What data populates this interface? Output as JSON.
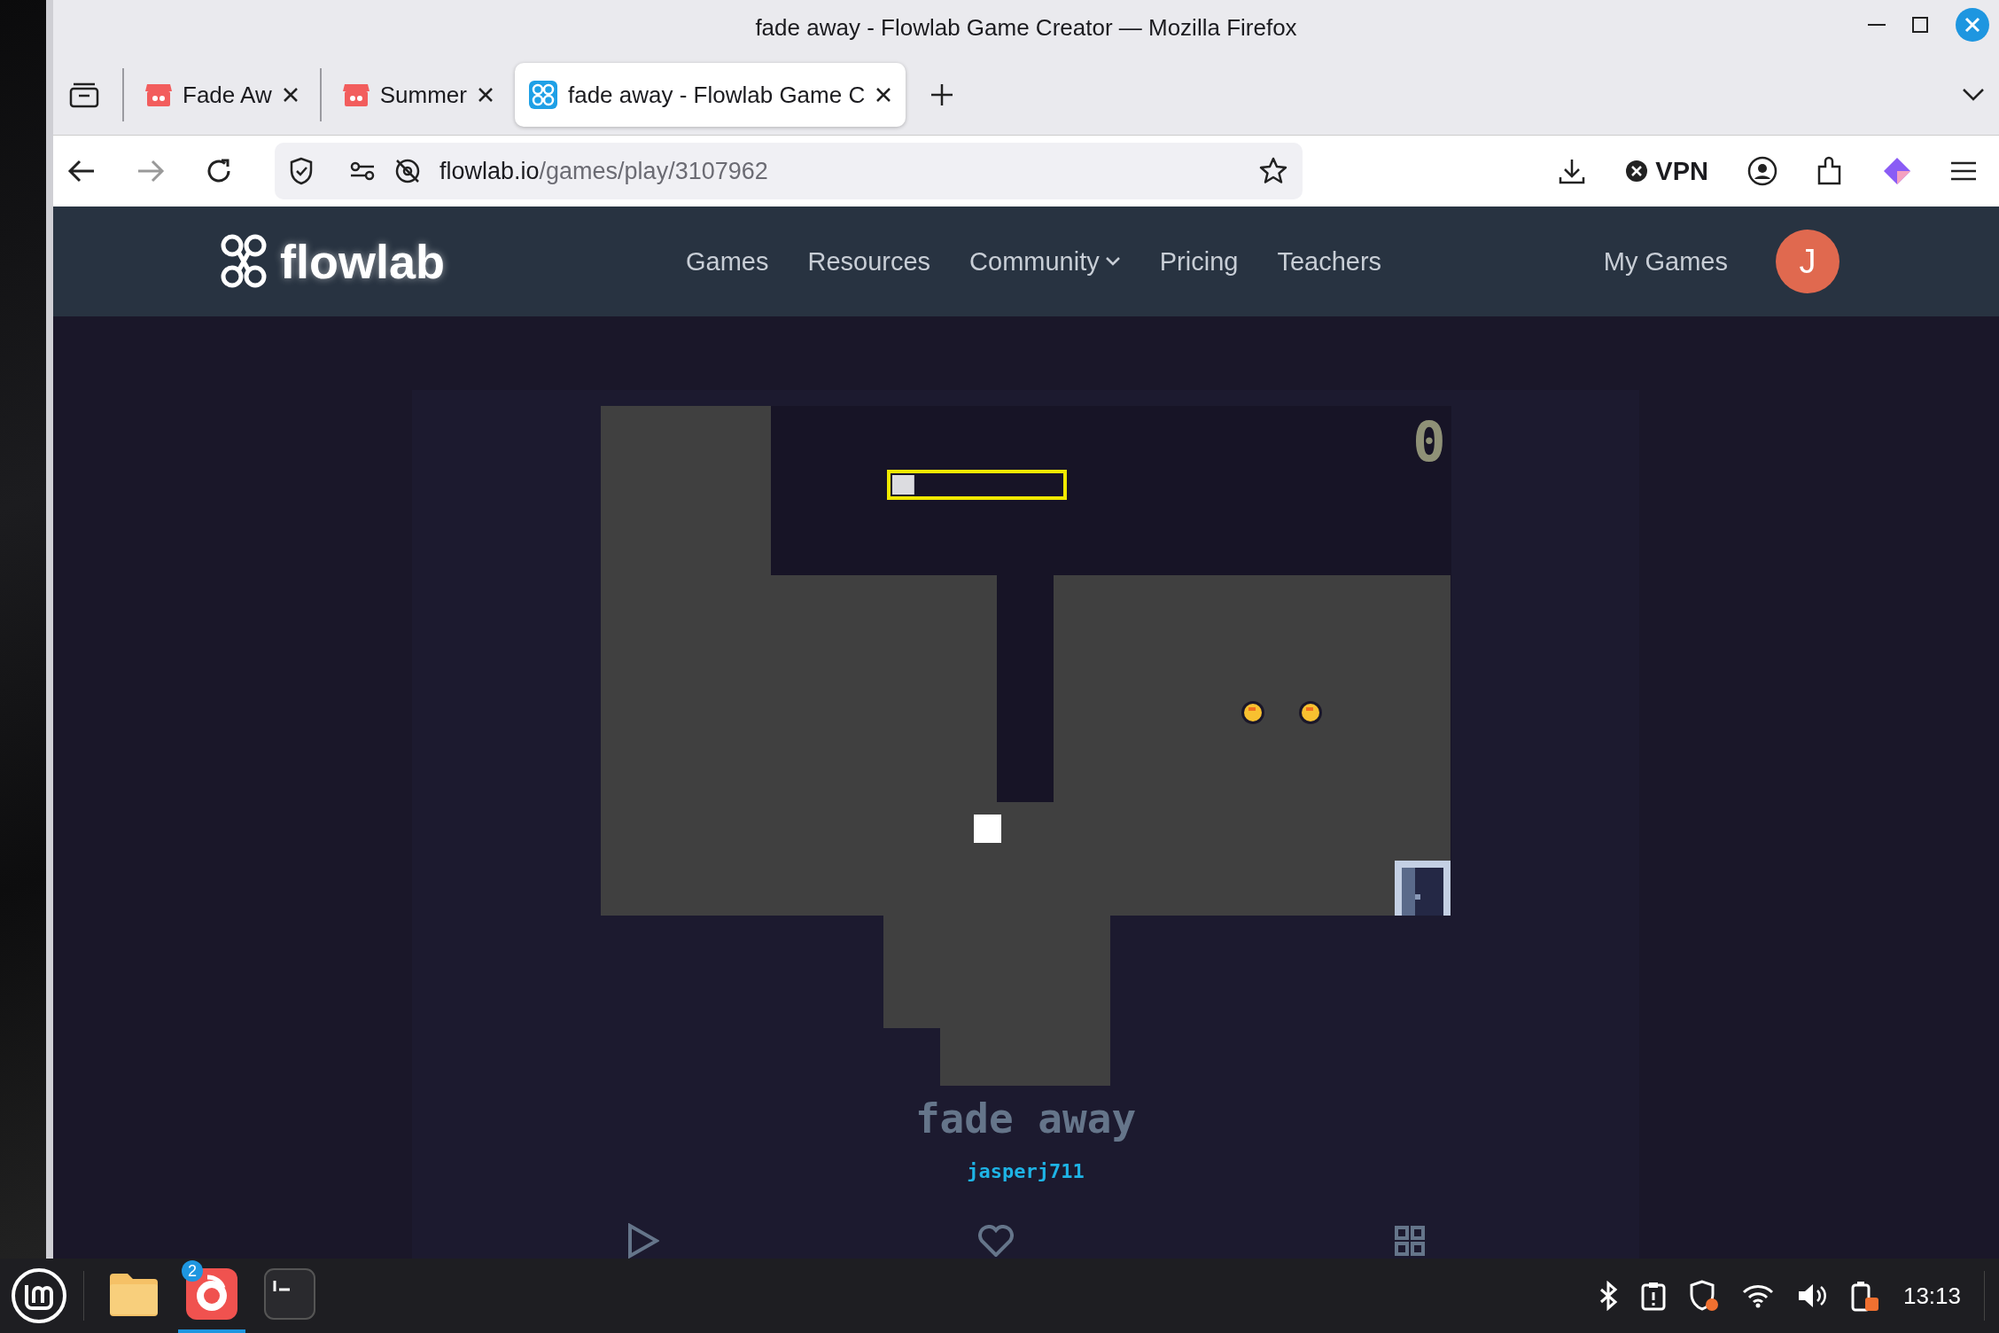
{
  "window": {
    "title": "fade away - Flowlab Game Creator — Mozilla Firefox"
  },
  "tabs": [
    {
      "label": "Fade Aw",
      "kind": "store",
      "selected": false
    },
    {
      "label": "Summer",
      "kind": "store",
      "selected": false
    },
    {
      "label": "fade away - Flowlab Game C",
      "kind": "flowlab",
      "selected": true
    }
  ],
  "address_bar": {
    "host": "flowlab.io",
    "path": "/games/play/3107962"
  },
  "toolbar": {
    "vpn_label": "VPN"
  },
  "site_nav": {
    "logo": "flowlab",
    "links": [
      {
        "label": "Games",
        "dropdown": false
      },
      {
        "label": "Resources",
        "dropdown": false
      },
      {
        "label": "Community",
        "dropdown": true
      },
      {
        "label": "Pricing",
        "dropdown": false
      },
      {
        "label": "Teachers",
        "dropdown": false
      }
    ],
    "my_games": "My Games",
    "avatar_initial": "J"
  },
  "game": {
    "score": "0",
    "timer_bar": {
      "level": 0.13
    },
    "title": "fade away",
    "author": "jasperj711"
  },
  "taskbar": {
    "apps": [
      {
        "kind": "files",
        "selected": false
      },
      {
        "kind": "firefox",
        "selected": true,
        "badge": "2"
      },
      {
        "kind": "terminal",
        "selected": false
      }
    ],
    "clock": "13:13"
  }
}
